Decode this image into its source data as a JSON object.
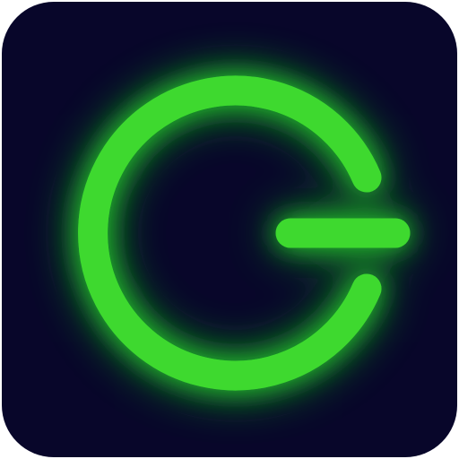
{
  "icon": {
    "name": "power-g-glyph-icon",
    "background_color": "#08062a",
    "glyph_color": "#3ed92f",
    "glow_color": "#2bff2a"
  }
}
